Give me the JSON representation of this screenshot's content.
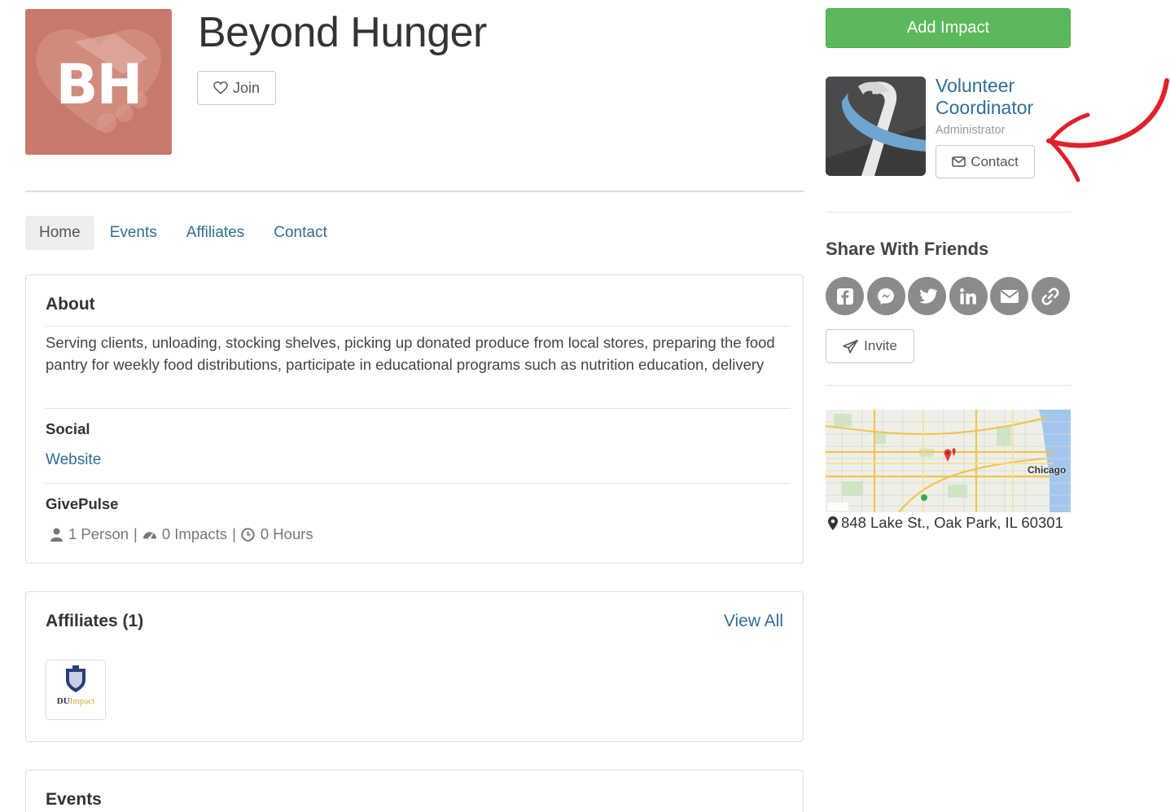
{
  "org": {
    "logo_initials": "BH",
    "name": "Beyond Hunger",
    "join_label": "Join"
  },
  "tabs": [
    {
      "label": "Home",
      "active": true
    },
    {
      "label": "Events",
      "active": false
    },
    {
      "label": "Affiliates",
      "active": false
    },
    {
      "label": "Contact",
      "active": false
    }
  ],
  "about": {
    "heading": "About",
    "text": "Serving clients, unloading, stocking shelves, picking up donated produce from local stores, preparing the food pantry for weekly food distributions, participate in educational programs such as nutrition education, delivery",
    "social_heading": "Social",
    "website_label": "Website",
    "givepulse_heading": "GivePulse",
    "stats": {
      "persons": "1 Person",
      "impacts": "0 Impacts",
      "hours": "0 Hours",
      "divider": "|"
    }
  },
  "affiliates": {
    "heading": "Affiliates (1)",
    "view_all_label": "View All",
    "items": [
      {
        "logo_text_primary": "DU",
        "logo_text_secondary": "Impact"
      }
    ]
  },
  "events": {
    "heading": "Events"
  },
  "sidebar": {
    "add_impact_label": "Add Impact",
    "coordinator": {
      "name": "Volunteer Coordinator",
      "role": "Administrator",
      "contact_label": "Contact"
    },
    "share_title": "Share With Friends",
    "share_icons": [
      "facebook-icon",
      "messenger-icon",
      "twitter-icon",
      "linkedin-icon",
      "email-icon",
      "link-icon"
    ],
    "invite_label": "Invite",
    "map": {
      "city_label": "Chicago"
    },
    "address": "848 Lake St., Oak Park, IL 60301"
  },
  "colors": {
    "link_blue": "#2f6e98",
    "success_green": "#5cb85c",
    "logo_bg": "#c8796b",
    "share_grey": "#8b8b8b",
    "annotation_red": "#e0202a"
  }
}
